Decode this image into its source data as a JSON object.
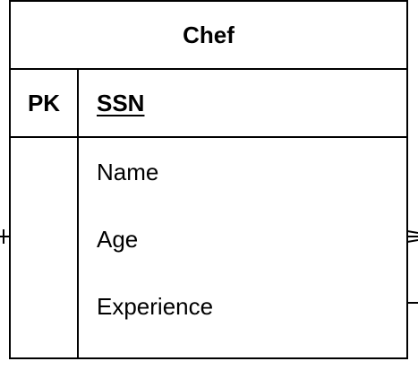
{
  "entity": {
    "title": "Chef",
    "primary_key": {
      "key_label": "PK",
      "attribute": "SSN"
    },
    "attributes": [
      "Name",
      "Age",
      "Experience"
    ]
  }
}
